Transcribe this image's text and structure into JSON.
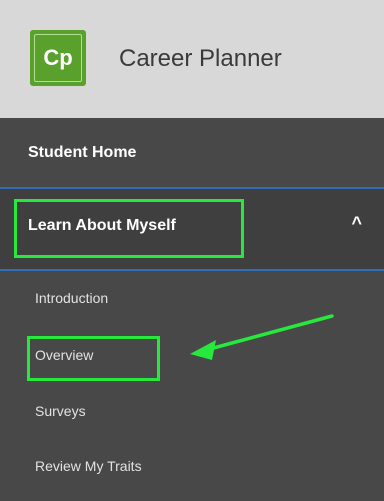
{
  "app": {
    "logo_text": "Cp",
    "title": "Career Planner"
  },
  "nav": {
    "student_home": "Student Home",
    "section": {
      "label": "Learn About Myself",
      "chevron": "^"
    },
    "items": [
      {
        "label": "Introduction"
      },
      {
        "label": "Overview"
      },
      {
        "label": "Surveys"
      },
      {
        "label": "Review My Traits"
      }
    ]
  },
  "colors": {
    "logo_green": "#5aa02c",
    "sidebar_bg": "#484848",
    "section_bg": "#3f3f3f",
    "accent_blue": "#2f6db5",
    "highlight_green": "#27e83c"
  },
  "icons": {
    "logo": "career-planner-logo-icon",
    "chevron": "chevron-up-icon",
    "annotation_arrow": "arrow-left-icon"
  }
}
